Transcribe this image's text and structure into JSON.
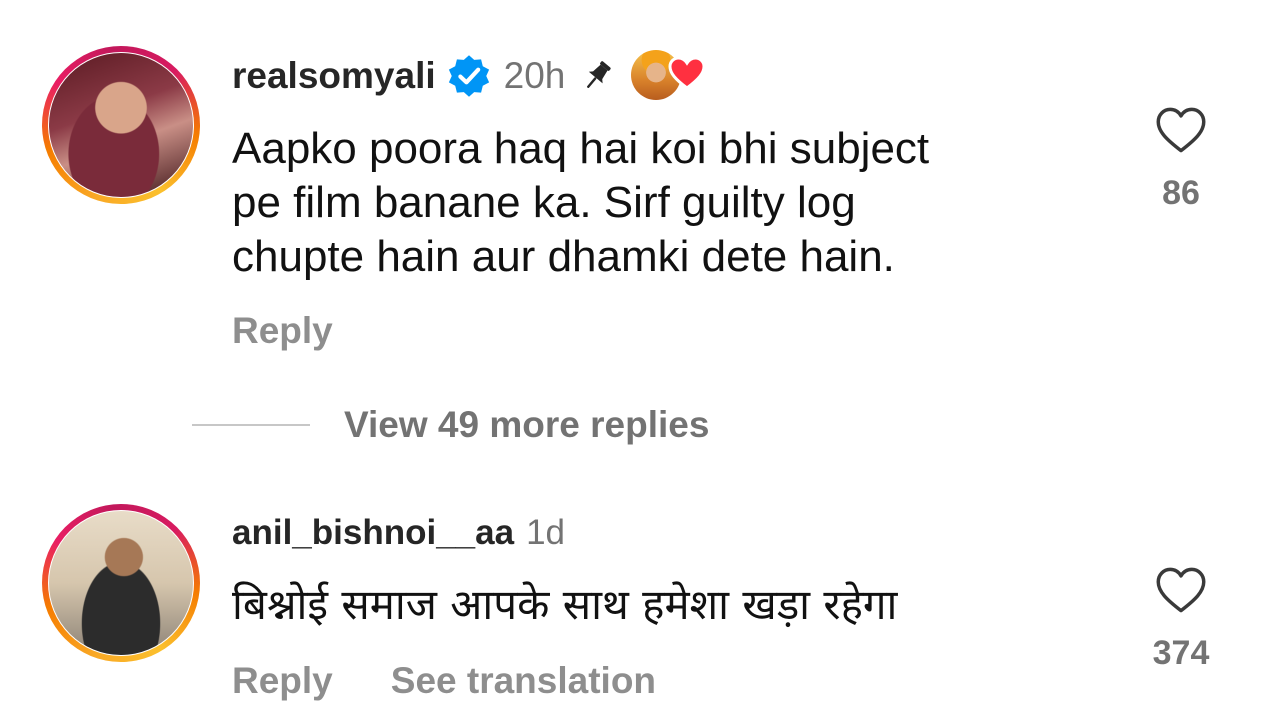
{
  "comments": [
    {
      "username": "realsomyali",
      "verified": true,
      "time": "20h",
      "pinned": true,
      "liked_by_creator": true,
      "text_lines": [
        "Aapko poora haq hai koi bhi subject",
        "pe film banane ka. Sirf guilty log",
        "chupte hain aur dhamki dete hain."
      ],
      "actions": [
        "Reply"
      ],
      "likes": "86",
      "icons": [
        "avatar",
        "verified-badge-icon",
        "pin-icon",
        "creator-avatar",
        "heart-icon",
        "like-heart-icon"
      ]
    },
    {
      "username": "anil_bishnoi__aa",
      "verified": false,
      "time": "1d",
      "text_lines": [
        "बिश्नोई समाज आपके साथ हमेशा खड़ा रहेगा"
      ],
      "actions": [
        "Reply",
        "See translation"
      ],
      "likes": "374",
      "icons": [
        "avatar",
        "like-heart-icon"
      ]
    }
  ],
  "view_replies": {
    "label": "View 49 more replies"
  },
  "colors": {
    "verified_blue": "#0095f6",
    "heart_red": "#ff3040",
    "muted_text": "#737373",
    "action_text": "#8e8e8e"
  }
}
